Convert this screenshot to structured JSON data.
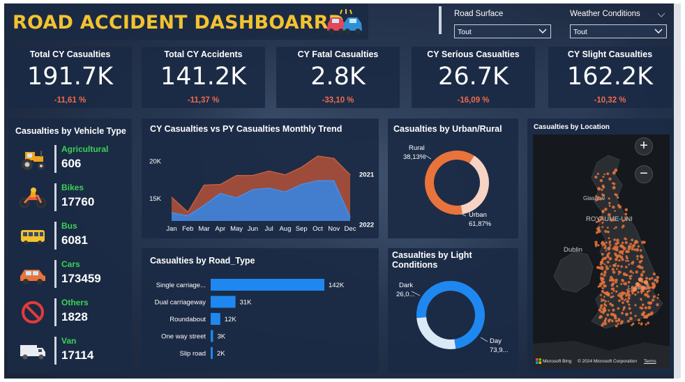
{
  "header": {
    "title": "ROAD ACCIDENT DASHBOARRD"
  },
  "filters": [
    {
      "label": "Road Surface",
      "value": "Tout"
    },
    {
      "label": "Weather Conditions",
      "value": "Tout"
    }
  ],
  "kpis": [
    {
      "label": "Total CY Casualties",
      "value": "191.7K",
      "change": "-11,61 %"
    },
    {
      "label": "Total CY Accidents",
      "value": "141.2K",
      "change": "-11,37 %"
    },
    {
      "label": "CY Fatal Casualties",
      "value": "2.8K",
      "change": "-33,10 %"
    },
    {
      "label": "CY Serious Casualties",
      "value": "26.7K",
      "change": "-16,09 %"
    },
    {
      "label": "CY Slight Casualties",
      "value": "162.2K",
      "change": "-10,32 %"
    }
  ],
  "vehicle_panel": {
    "title": "Casualties by Vehicle Type",
    "items": [
      {
        "name": "Agricultural",
        "value": "606",
        "icon": "tractor-icon"
      },
      {
        "name": "Bikes",
        "value": "17760",
        "icon": "motorbike-icon"
      },
      {
        "name": "Bus",
        "value": "6081",
        "icon": "bus-icon"
      },
      {
        "name": "Cars",
        "value": "173459",
        "icon": "car-icon"
      },
      {
        "name": "Others",
        "value": "1828",
        "icon": "no-entry-icon"
      },
      {
        "name": "Van",
        "value": "17114",
        "icon": "van-icon"
      }
    ]
  },
  "colors": {
    "accent_title": "#f2c230",
    "negative": "#ef6a4d",
    "vehicle_label": "#39d353",
    "series_2022": "#3e7fd6",
    "series_2021": "#b4523a",
    "bar": "#1e88f0",
    "urban": "#e8743b",
    "rural": "#f6d3c2",
    "day": "#1e88f0",
    "dark": "#dbe8f5"
  },
  "trend_chart": {
    "title": "CY Casualties vs PY Casualties Monthly Trend",
    "series_labels": [
      "2021",
      "2022"
    ],
    "y_ticks": [
      "20K",
      "15K"
    ]
  },
  "road_chart": {
    "title": "Casualties by Road_Type"
  },
  "urban_chart": {
    "title": "Casualties by Urban/Rural",
    "labels": [
      {
        "name": "Rural",
        "pct": "38,13%"
      },
      {
        "name": "Urban",
        "pct": "61,87%"
      }
    ]
  },
  "light_chart": {
    "title": "Casualties by Light Conditions",
    "labels": [
      {
        "name": "Dark",
        "pct": "26,0..."
      },
      {
        "name": "Day",
        "pct": "73,9..."
      }
    ]
  },
  "map": {
    "title": "Casualties by Location",
    "labels": [
      "Glasgow",
      "ROYAUME-UNI",
      "Dublin",
      "Londres"
    ],
    "zoom_in": "+",
    "zoom_out": "−",
    "attribution_logo": "Microsoft Bing",
    "copyright": "© 2024 Microsoft Corporation",
    "terms": "Terms"
  },
  "chart_data": [
    {
      "type": "area",
      "title": "CY Casualties vs PY Casualties Monthly Trend",
      "x": [
        "Jan",
        "Feb",
        "Mar",
        "Apr",
        "May",
        "Jun",
        "Jul",
        "Aug",
        "Sep",
        "Oct",
        "Nov",
        "Dec"
      ],
      "y_ticks": [
        "20K",
        "15K"
      ],
      "ylim": [
        12000,
        22000
      ],
      "series": [
        {
          "name": "2021",
          "values": [
            15200,
            13200,
            16800,
            16900,
            18100,
            18100,
            18700,
            18200,
            19200,
            20700,
            20400,
            18200
          ]
        },
        {
          "name": "2022",
          "values": [
            13100,
            12700,
            14100,
            15700,
            15100,
            16200,
            16400,
            15900,
            16900,
            17400,
            17400,
            12500
          ]
        }
      ]
    },
    {
      "type": "bar",
      "orientation": "horizontal",
      "title": "Casualties by Road_Type",
      "categories": [
        "Single carriage...",
        "Dual carriageway",
        "Roundabout",
        "One way street",
        "Slip road"
      ],
      "values": [
        142,
        31,
        12,
        3,
        2
      ],
      "value_labels": [
        "142K",
        "31K",
        "12K",
        "3K",
        "2K"
      ]
    },
    {
      "type": "pie",
      "donut": true,
      "title": "Casualties by Urban/Rural",
      "categories": [
        "Rural",
        "Urban"
      ],
      "values": [
        38.13,
        61.87
      ]
    },
    {
      "type": "pie",
      "donut": true,
      "title": "Casualties by Light Conditions",
      "categories": [
        "Dark",
        "Day"
      ],
      "values": [
        26.0,
        73.9
      ]
    }
  ]
}
